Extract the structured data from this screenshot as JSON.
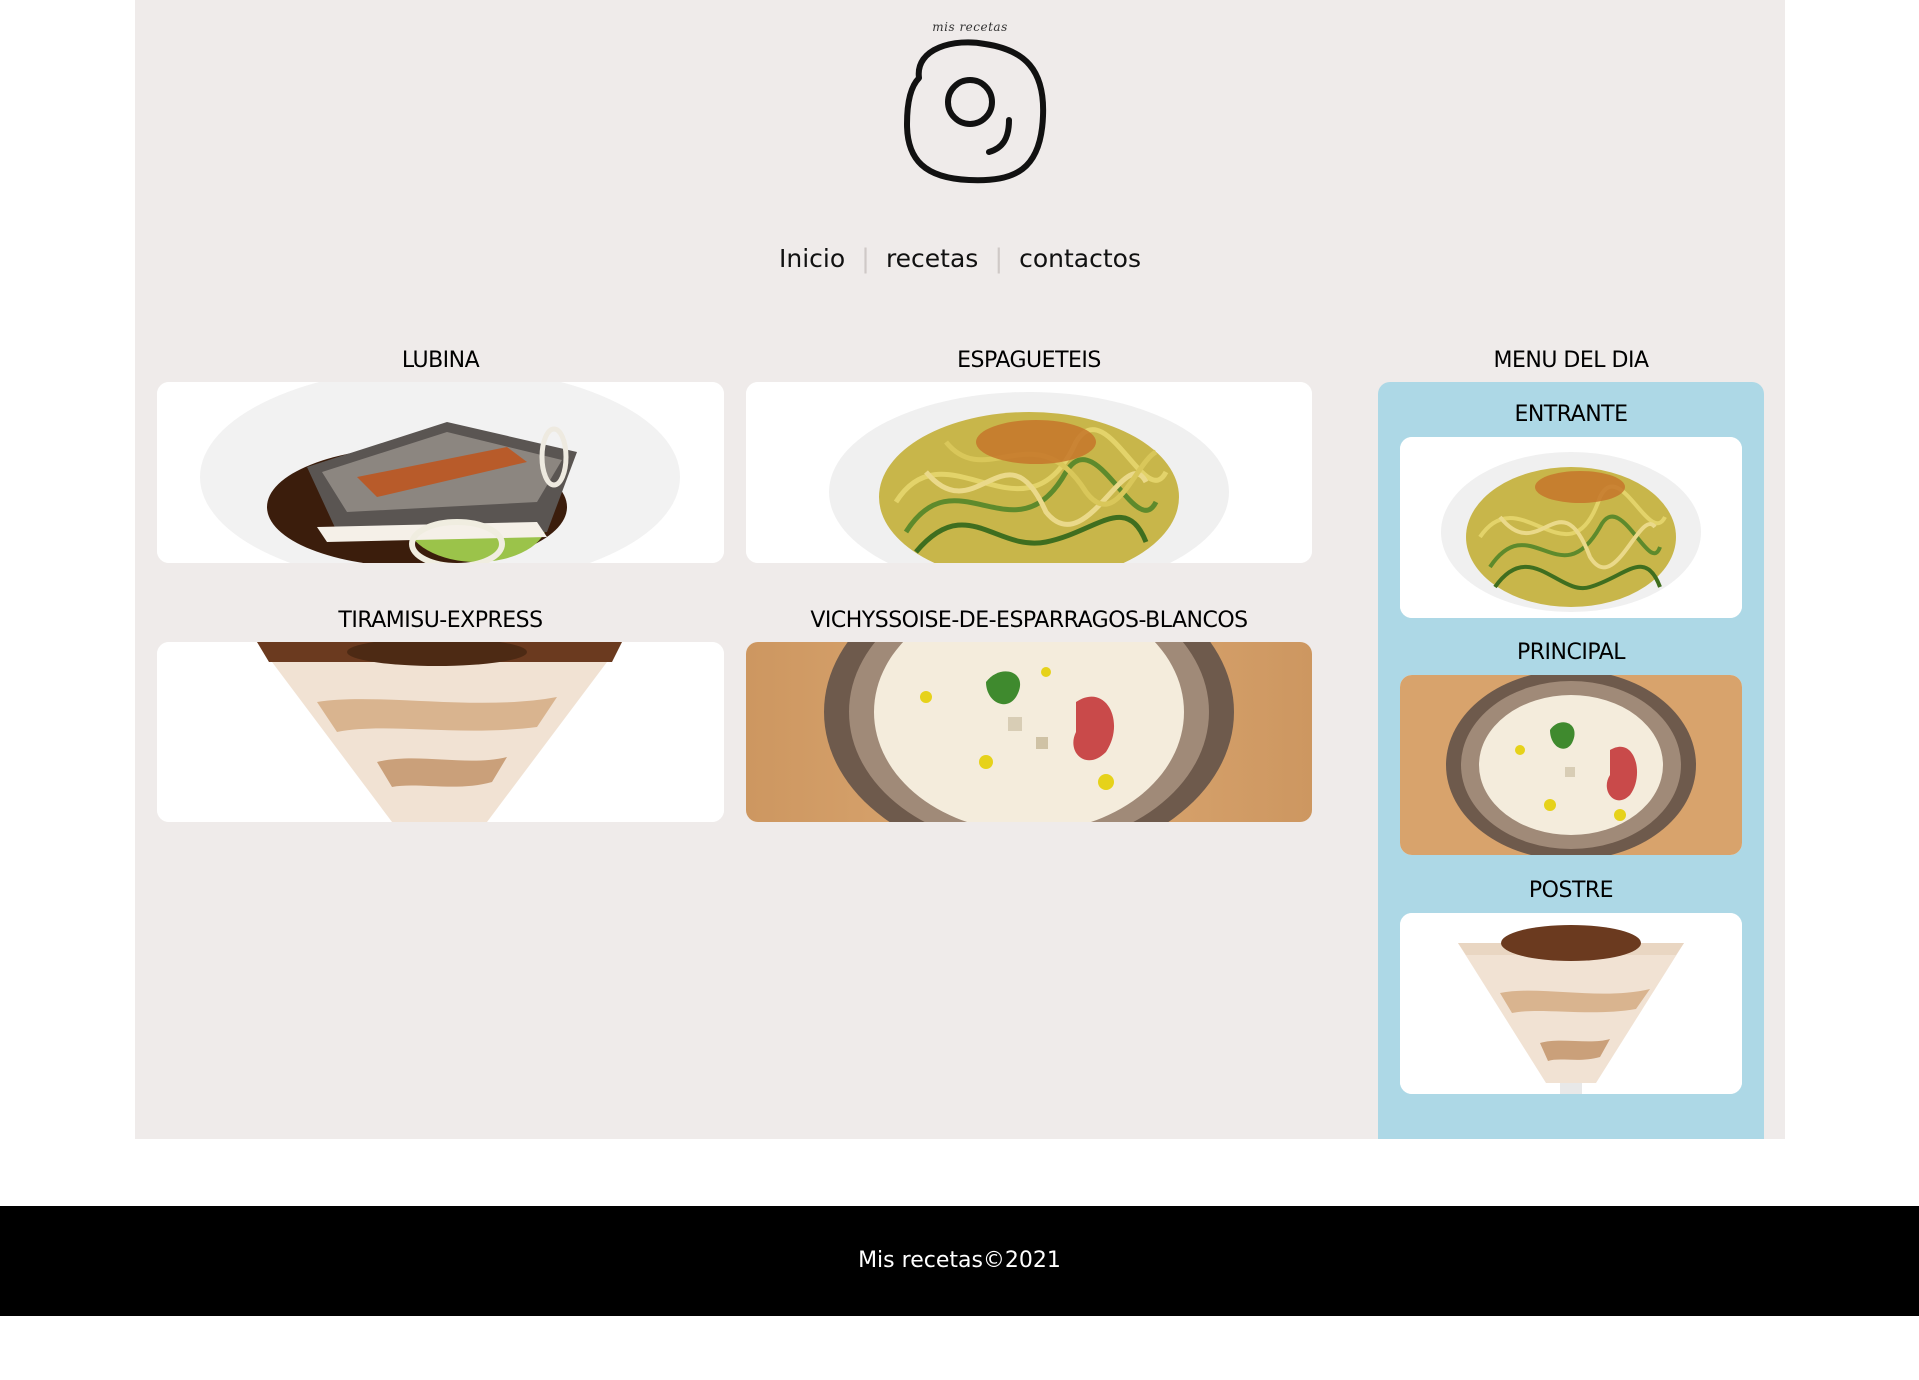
{
  "logo": {
    "caption": "mis recetas"
  },
  "nav": {
    "items": [
      {
        "label": "Inicio"
      },
      {
        "label": "recetas"
      },
      {
        "label": "contactos"
      }
    ],
    "separator": "|"
  },
  "recipes": [
    {
      "title": "LUBINA"
    },
    {
      "title": "ESPAGUETEIS"
    },
    {
      "title": "TIRAMISU-EXPRESS"
    },
    {
      "title": "VICHYSSOISE-DE-ESPARRAGOS-BLANCOS"
    }
  ],
  "menu_del_dia": {
    "title": "MENU DEL DIA",
    "courses": [
      {
        "label": "ENTRANTE"
      },
      {
        "label": "PRINCIPAL"
      },
      {
        "label": "POSTRE"
      }
    ]
  },
  "footer": {
    "text": "Mis recetas©2021"
  },
  "colors": {
    "page_background": "#efebea",
    "menu_panel": "#add8e6",
    "footer_background": "#000000",
    "footer_text": "#ffffff"
  }
}
